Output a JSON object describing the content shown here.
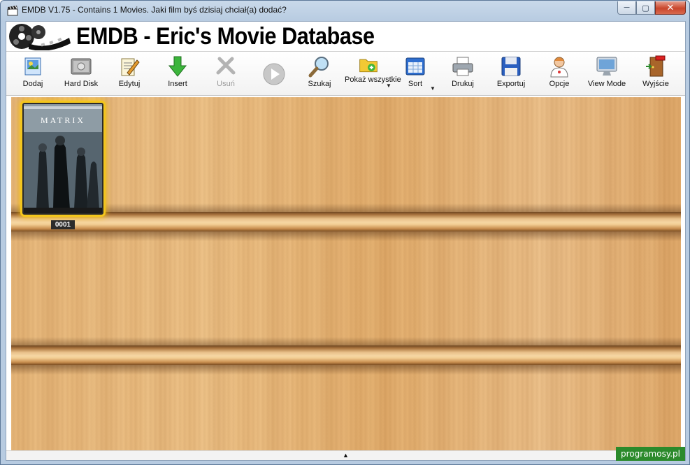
{
  "window": {
    "title": "EMDB V1.75 - Contains 1 Movies. Jaki film byś dzisiaj chciał(a) dodać?",
    "minimize": "─",
    "maximize": "▢",
    "close": "✕"
  },
  "header": {
    "app_title": "EMDB - Eric's Movie Database"
  },
  "toolbar": {
    "items": [
      {
        "label": "Dodaj",
        "icon": "add-movie-icon"
      },
      {
        "label": "Hard Disk",
        "icon": "hard-disk-icon"
      },
      {
        "label": "Edytuj",
        "icon": "edit-icon"
      },
      {
        "label": "Insert",
        "icon": "insert-arrow-icon"
      },
      {
        "label": "Usuń",
        "icon": "delete-tools-icon",
        "disabled": true
      },
      {
        "label": "",
        "icon": "play-icon",
        "disabled": true
      },
      {
        "label": "Szukaj",
        "icon": "search-icon"
      },
      {
        "label": "Pokaż wszystkie",
        "icon": "show-all-folder-icon",
        "dropdown": true
      },
      {
        "label": "Sort",
        "icon": "sort-icon",
        "dropdown": true
      },
      {
        "label": "Drukuj",
        "icon": "print-icon"
      },
      {
        "label": "Exportuj",
        "icon": "export-disk-icon"
      },
      {
        "label": "Opcje",
        "icon": "options-user-icon"
      },
      {
        "label": "View Mode",
        "icon": "view-mode-monitor-icon"
      },
      {
        "label": "Wyjście",
        "icon": "exit-door-icon"
      }
    ]
  },
  "shelf": {
    "movies": [
      {
        "number": "0001",
        "cover_title": "MATRIX"
      }
    ]
  },
  "watermark": "programosy.pl",
  "colors": {
    "selection_glow": "#f3c61c",
    "wood_light": "#edc186",
    "wood_dark": "#7a4d22"
  }
}
